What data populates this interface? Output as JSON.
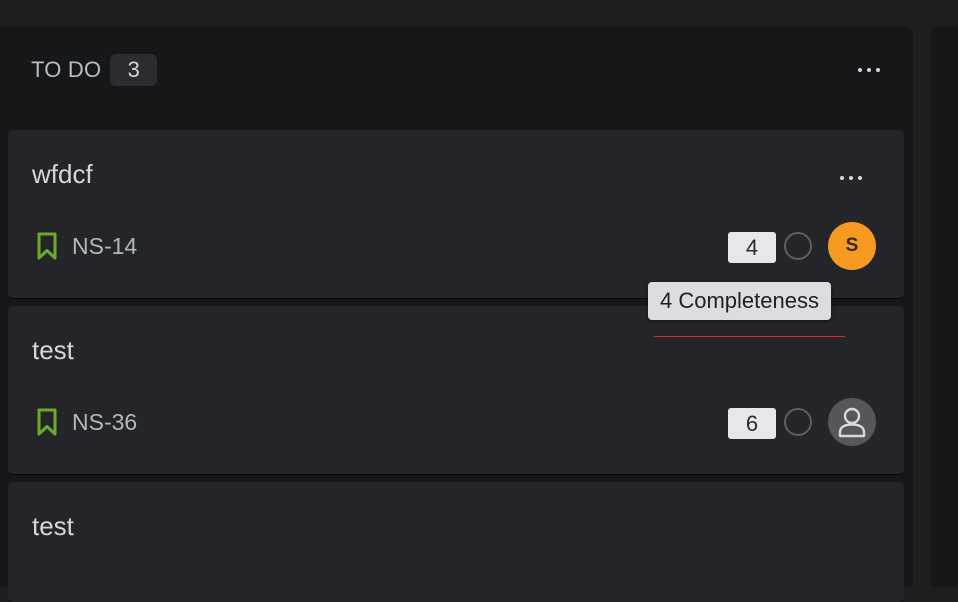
{
  "column": {
    "title": "TO DO",
    "count": "3"
  },
  "cards": [
    {
      "title": "wfdcf",
      "key": "NS-14",
      "issue_type_icon": "bookmark-icon",
      "points": "4",
      "assignee_initial": "S",
      "assignee_color": "#f79a21"
    },
    {
      "title": "test",
      "key": "NS-36",
      "issue_type_icon": "bookmark-icon",
      "points": "6",
      "assignee_icon": "user-icon"
    },
    {
      "title": "test"
    }
  ],
  "tooltip": {
    "text": "4 Completeness"
  },
  "colors": {
    "background": "#1d1e20",
    "column": "#161719",
    "card": "#242528",
    "bookmark": "#6bab2a",
    "avatar_orange": "#f79a21",
    "underline": "#d12e2e"
  }
}
